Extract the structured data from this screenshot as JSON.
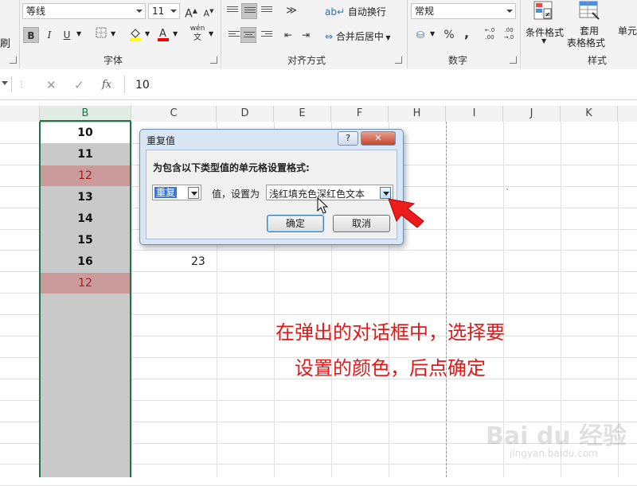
{
  "ribbon": {
    "font_name": "等线",
    "font_size": "11",
    "grow_font": "A",
    "shrink_font": "A",
    "bold": "B",
    "italic": "I",
    "underline": "U",
    "phonetic": "wén",
    "partial_left_label": "刷",
    "font_group_label": "字体",
    "wrap_text": "自动换行",
    "merge_center": "合并后居中",
    "alignment_group_label": "对齐方式",
    "number_format": "常规",
    "percent": "%",
    "comma": ",",
    "inc_decimal": "←.0 .00",
    "dec_decimal": ".00 →.0",
    "number_group_label": "数字",
    "conditional_format": "条件格式",
    "format_as_table_line1": "套用",
    "format_as_table_line2": "表格格式",
    "cell_styles": "单元",
    "styles_group_label": "样式",
    "colors": {
      "fill": "#ffff00",
      "font": "#ff0000",
      "accent": "#217346"
    }
  },
  "formula_bar": {
    "cancel": "✕",
    "enter": "✓",
    "fx": "fx",
    "value": "10"
  },
  "columns": [
    "B",
    "C",
    "D",
    "E",
    "F",
    "H",
    "I",
    "J",
    "K"
  ],
  "column_b": [
    {
      "value": "10",
      "style": "first"
    },
    {
      "value": "11",
      "style": "normal"
    },
    {
      "value": "12",
      "style": "dup"
    },
    {
      "value": "13",
      "style": "normal"
    },
    {
      "value": "14",
      "style": "normal"
    },
    {
      "value": "15",
      "style": "normal"
    },
    {
      "value": "16",
      "style": "normal"
    },
    {
      "value": "12",
      "style": "dup"
    }
  ],
  "column_c_value": "23",
  "dialog": {
    "title": "重复值",
    "help": "?",
    "close": "✕",
    "prompt": "为包含以下类型值的单元格设置格式:",
    "type_value": "重复",
    "mid_label": "值，设置为",
    "format_value": "浅红填充色深红色文本",
    "ok": "确定",
    "cancel": "取消"
  },
  "annotation": {
    "line1": "在弹出的对话框中，选择要",
    "line2": "设置的颜色，后点确定"
  },
  "watermark": {
    "brand": "Bai du 经验",
    "url": "jingyan.baidu.com"
  }
}
